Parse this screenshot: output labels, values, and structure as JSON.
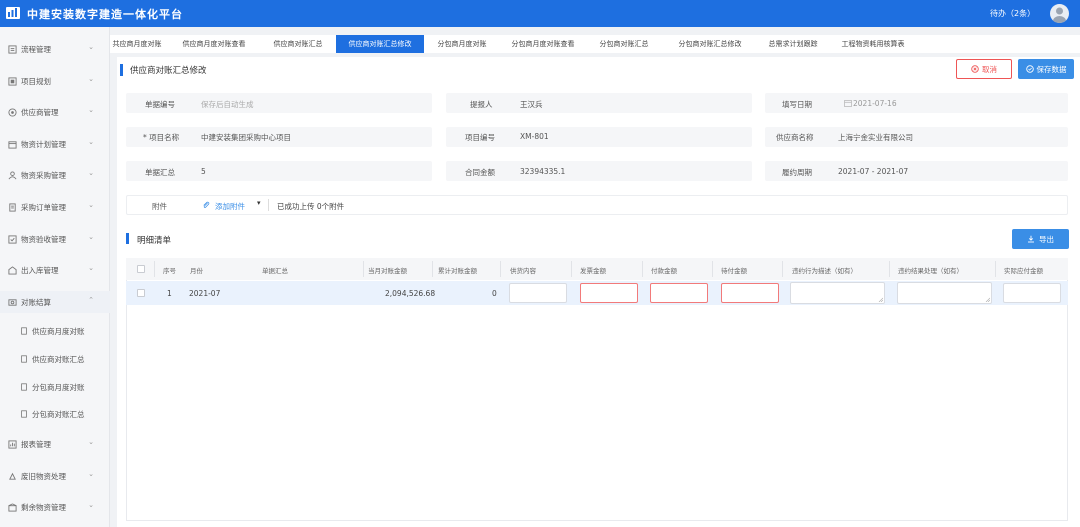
{
  "header": {
    "title": "中建安装数字建造一体化平台",
    "pending": "待办（2条）"
  },
  "sidebar": {
    "items": [
      {
        "label": "流程管理",
        "icon": "flow-icon"
      },
      {
        "label": "项目规划",
        "icon": "plan-icon"
      },
      {
        "label": "供应商管理",
        "icon": "supplier-icon"
      },
      {
        "label": "物资计划管理",
        "icon": "material-plan-icon"
      },
      {
        "label": "物资采购管理",
        "icon": "purchase-icon"
      },
      {
        "label": "采购订单管理",
        "icon": "order-icon"
      },
      {
        "label": "物资验收管理",
        "icon": "acceptance-icon"
      },
      {
        "label": "出入库管理",
        "icon": "warehouse-icon"
      },
      {
        "label": "对账结算",
        "icon": "settlement-icon"
      }
    ],
    "sub_items": [
      {
        "label": "供应商月度对账"
      },
      {
        "label": "供应商对账汇总"
      },
      {
        "label": "分包商月度对账"
      },
      {
        "label": "分包商对账汇总"
      }
    ],
    "bottom_items": [
      {
        "label": "报表管理",
        "icon": "report-icon"
      },
      {
        "label": "废旧物资处理",
        "icon": "recycle-icon"
      },
      {
        "label": "剩余物资管理",
        "icon": "surplus-icon"
      }
    ]
  },
  "tabs": [
    "共应商月度对账",
    "供应商月度对账查看",
    "供应商对账汇总",
    "供应商对账汇总修改",
    "分包商月度对账",
    "分包商月度对账查看",
    "分包商对账汇总",
    "分包商对账汇总修改",
    "总需求计划跟踪",
    "工程物资耗用核算表"
  ],
  "active_tab_index": 3,
  "page": {
    "title": "供应商对账汇总修改",
    "cancel": "取消",
    "save": "保存数据"
  },
  "form": {
    "doc_no_label": "单据编号",
    "doc_no_placeholder": "保存后自动生成",
    "proposer_label": "提报人",
    "proposer": "王汉兵",
    "fill_date_label": "填写日期",
    "fill_date": "2021-07-16",
    "project_name_label": "* 项目名称",
    "project_name": "中建安装集团采购中心项目",
    "project_no_label": "项目编号",
    "project_no": "XM-801",
    "supplier_label": "供应商名称",
    "supplier": "上海宁金实业有限公司",
    "doc_sum_label": "单据汇总",
    "doc_sum": "5",
    "contract_amount_label": "合同金额",
    "contract_amount": "32394335.1",
    "period_label": "履约周期",
    "period": "2021-07 - 2021-07",
    "attach_label": "附件",
    "attach_add": "添加附件",
    "attach_status": "已成功上传 0个附件"
  },
  "detail": {
    "title": "明细清单",
    "export": "导出",
    "columns": [
      "序号",
      "月份",
      "单据汇总",
      "当月对账金额",
      "累计对账金额",
      "供货内容",
      "发票金额",
      "付款金额",
      "待付金额",
      "违约行为描述（如有）",
      "违约结果处理（如有）",
      "实际应付金额"
    ],
    "rows": [
      {
        "no": "1",
        "month": "2021-07",
        "sum": "",
        "month_amount": "2,094,526.68",
        "total_amount": "0"
      }
    ]
  }
}
